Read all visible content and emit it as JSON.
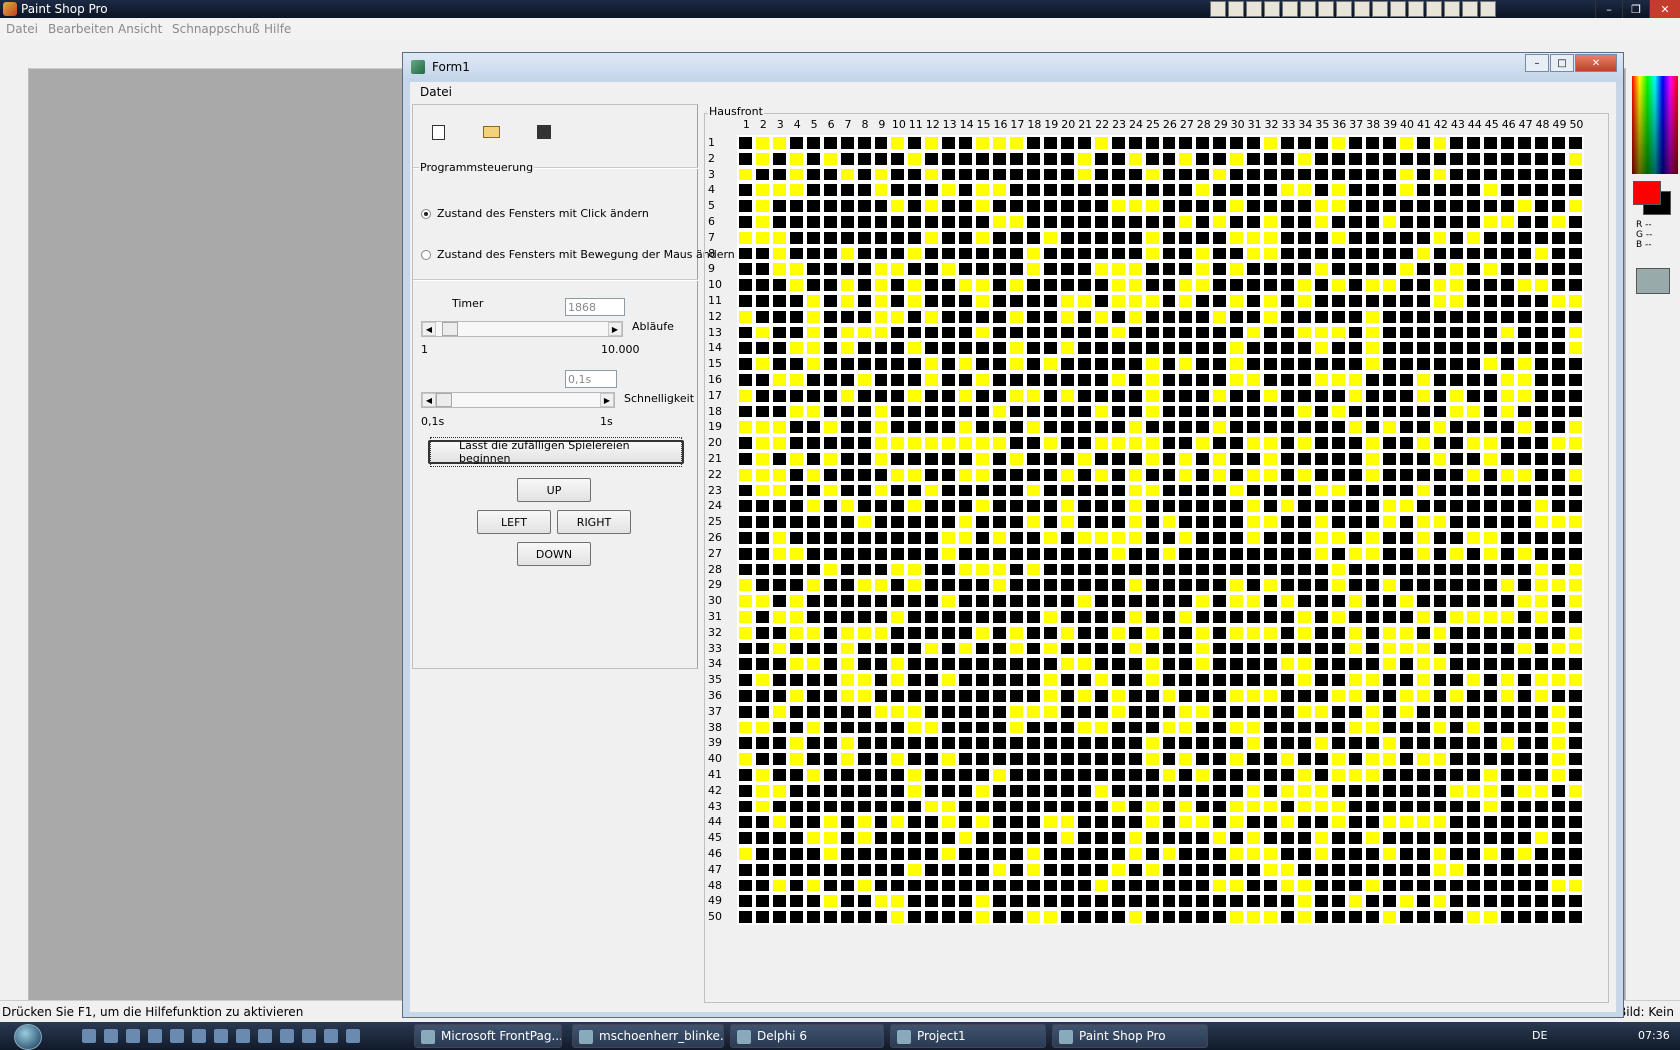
{
  "psp": {
    "title": "Paint Shop Pro",
    "menu": [
      "Datei",
      "Bearbeiten",
      "Ansicht",
      "Schnappschuß",
      "Hilfe"
    ],
    "status_left": "Drücken Sie F1, um die Hilfefunktion zu aktivieren",
    "status_right": "Bild: Kein",
    "rgb_readout": [
      "R --",
      "G --",
      "B --"
    ]
  },
  "form": {
    "title": "Form1",
    "menu": "Datei",
    "groupbox_label": "Programmsteuerung",
    "radio1_label": "Zustand des Fensters mit Click ändern",
    "radio2_label": "Zustand des Fensters mit Bewegung der Maus ändern",
    "timer_label": "Timer",
    "timer_value": "1868",
    "ablaeufe_label": "Abläufe",
    "slider1_min": "1",
    "slider1_max": "10.000",
    "slider1_position": 0.04,
    "speed_value": "0,1s",
    "speed_label": "Schnelligkeit",
    "slider2_min": "0,1s",
    "slider2_max": "1s",
    "slider2_position": 0.0,
    "start_button": "Lasst die zufälligen Spielereien beginnen",
    "up_button": "UP",
    "left_button": "LEFT",
    "right_button": "RIGHT",
    "down_button": "DOWN",
    "grid_title": "Hausfront",
    "grid_cols": 50,
    "grid_rows": 50
  },
  "taskbar": {
    "tasks": [
      "Microsoft FrontPag...",
      "mschoenherr_blinke...",
      "Delphi 6",
      "Project1",
      "Paint Shop Pro"
    ],
    "lang": "DE",
    "clock": "07:36"
  },
  "colors": {
    "on": "#ffff00",
    "off": "#000000",
    "fg": "#ff0000",
    "bg": "#000000"
  }
}
